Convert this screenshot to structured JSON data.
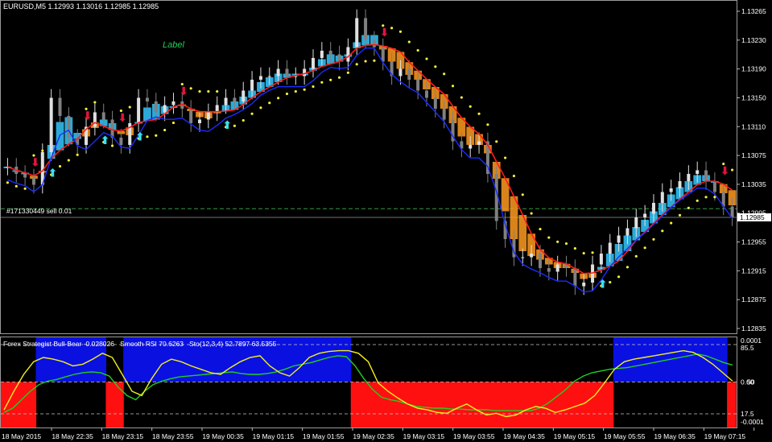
{
  "header": {
    "symbol": "EURUSD,M5",
    "ohlc": "1.12993 1.13016 1.12985 1.12985"
  },
  "chart_label": "Label",
  "order_label": "#171330449 sell 0.01",
  "current_price": "1.12985",
  "indicator_header": {
    "name": "Forex Strategist Bull-Bear",
    "value": "-0.028026",
    "rsi_label": "Smooth RSI",
    "rsi_value": "70.6263",
    "sto_label": "Sto(12,3,4)",
    "sto_values": "52.7897 63.5355"
  },
  "colors": {
    "bg": "#000000",
    "grid": "#4a4a4a",
    "candle_bull": "#e0e0e0",
    "candle_bear": "#808080",
    "band_up": "#32c8ff",
    "band_down": "#ff9a20",
    "ma_red": "#ff1c1c",
    "ma_blue": "#1a2cff",
    "dots_yellow": "#f4f040",
    "signal_up": "#38e0f0",
    "signal_down": "#e0143c",
    "ind_blue": "#0a10e0",
    "ind_red": "#ff1010",
    "stoch_yellow": "#f4f020",
    "rsi_green": "#20d020"
  },
  "chart_data": [
    {
      "type": "candlestick",
      "title": "EURUSD,M5",
      "price_axis": [
        "1.13265",
        "1.13230",
        "1.13190",
        "1.13150",
        "1.13110",
        "1.13075",
        "1.13035",
        "1.12995",
        "1.12955",
        "1.12915",
        "1.12875",
        "1.12835"
      ],
      "ylim": [
        1.12825,
        1.13285
      ],
      "time_axis": [
        "18 May 2015",
        "18 May 22:35",
        "18 May 23:15",
        "18 May 23:55",
        "19 May 00:35",
        "19 May 01:15",
        "19 May 01:55",
        "19 May 02:35",
        "19 May 03:15",
        "19 May 03:55",
        "19 May 04:35",
        "19 May 05:15",
        "19 May 05:55",
        "19 May 06:35",
        "19 May 07:15"
      ],
      "closes": [
        1.13055,
        1.13045,
        1.1304,
        1.1303,
        1.13075,
        1.1315,
        1.13125,
        1.13095,
        1.13085,
        1.1311,
        1.1313,
        1.1312,
        1.13095,
        1.13085,
        1.13115,
        1.1315,
        1.13145,
        1.1313,
        1.1314,
        1.13145,
        1.13135,
        1.13115,
        1.1312,
        1.1313,
        1.1314,
        1.1315,
        1.13145,
        1.1316,
        1.13175,
        1.1318,
        1.1318,
        1.1319,
        1.1318,
        1.1318,
        1.1319,
        1.13205,
        1.13215,
        1.1321,
        1.132,
        1.1322,
        1.1326,
        1.1323,
        1.1322,
        1.132,
        1.1318,
        1.1319,
        1.13175,
        1.1316,
        1.1315,
        1.13135,
        1.1312,
        1.1309,
        1.1308,
        1.13085,
        1.1309,
        1.13045,
        1.1298,
        1.12955,
        1.1293,
        1.1293,
        1.12935,
        1.12915,
        1.1291,
        1.1292,
        1.12915,
        1.1289,
        1.12895,
        1.1292,
        1.12935,
        1.1295,
        1.1296,
        1.1297,
        1.12985,
        1.1299,
        1.13005,
        1.1302,
        1.13025,
        1.13035,
        1.13045,
        1.1305,
        1.13035,
        1.1302,
        1.13,
        1.12985
      ],
      "levels": {
        "current": 1.12985,
        "order": 1.12997
      }
    },
    {
      "type": "line",
      "title": "Forex Strategist Bull-Bear",
      "ylim": [
        -0.0001,
        0.0001
      ],
      "axis_labels": [
        "0.0001",
        "85.5",
        "0.00",
        "50",
        "17.5",
        "-0.0001"
      ],
      "bull_bear_histogram": [
        -1,
        -1,
        -1,
        -1,
        1,
        1,
        1,
        1,
        1,
        1,
        1,
        1,
        -1,
        -1,
        1,
        1,
        1,
        1,
        1,
        1,
        1,
        1,
        1,
        1,
        1,
        1,
        1,
        1,
        1,
        1,
        1,
        1,
        1,
        1,
        1,
        1,
        1,
        1,
        1,
        1,
        -1,
        -1,
        -1,
        -1,
        -1,
        -1,
        -1,
        -1,
        -1,
        -1,
        -1,
        -1,
        -1,
        -1,
        -1,
        -1,
        -1,
        -1,
        -1,
        -1,
        -1,
        -1,
        -1,
        -1,
        -1,
        -1,
        -1,
        -1,
        -1,
        -1,
        1,
        1,
        1,
        1,
        1,
        1,
        1,
        1,
        1,
        1,
        1,
        1,
        1,
        -1
      ],
      "series": [
        {
          "name": "Smooth RSI",
          "values": [
            15,
            20,
            30,
            40,
            48,
            52,
            54,
            57,
            60,
            62,
            63,
            62,
            58,
            45,
            35,
            30,
            40,
            48,
            52,
            55,
            57,
            58,
            59,
            60,
            61,
            62,
            63,
            61,
            60,
            60,
            61,
            63,
            66,
            70,
            72,
            74,
            77,
            80,
            82,
            81,
            70,
            55,
            42,
            33,
            30,
            28,
            25,
            22,
            21,
            20,
            20,
            19,
            19,
            18,
            18,
            18,
            17,
            17,
            17,
            17,
            17,
            20,
            26,
            34,
            42,
            52,
            58,
            62,
            64,
            66,
            67,
            68,
            70,
            72,
            74,
            76,
            78,
            80,
            82,
            84,
            82,
            78,
            74,
            71
          ]
        },
        {
          "name": "Sto(12,3,4)",
          "values": [
            18,
            40,
            60,
            75,
            80,
            78,
            75,
            70,
            72,
            78,
            85,
            80,
            60,
            40,
            35,
            55,
            72,
            78,
            75,
            70,
            66,
            62,
            60,
            68,
            75,
            80,
            82,
            70,
            62,
            58,
            68,
            80,
            85,
            87,
            88,
            88,
            85,
            75,
            50,
            40,
            32,
            25,
            20,
            18,
            15,
            14,
            20,
            25,
            18,
            12,
            14,
            10,
            12,
            18,
            22,
            20,
            15,
            18,
            22,
            26,
            35,
            50,
            66,
            75,
            78,
            80,
            82,
            84,
            86,
            88,
            86,
            80,
            72,
            62,
            52
          ]
        }
      ]
    }
  ]
}
